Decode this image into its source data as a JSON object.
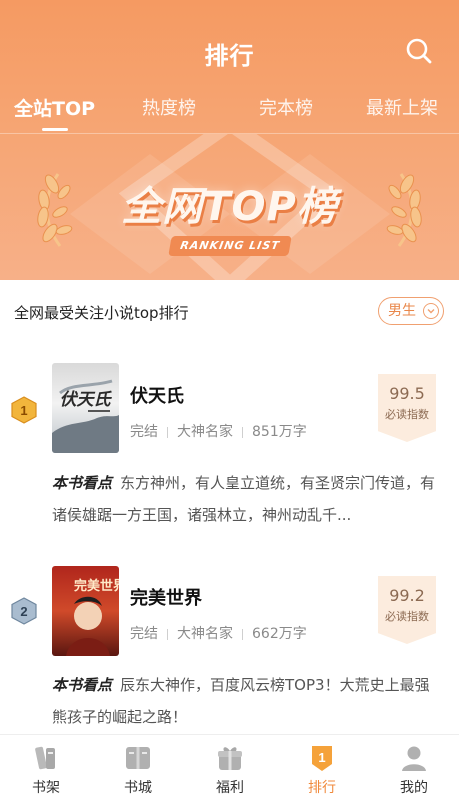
{
  "header": {
    "title": "排行",
    "search_icon": "search-icon"
  },
  "tabs": [
    {
      "label": "全站TOP",
      "active": true
    },
    {
      "label": "热度榜",
      "active": false
    },
    {
      "label": "完本榜",
      "active": false
    },
    {
      "label": "最新上架",
      "active": false
    }
  ],
  "banner": {
    "title": "全网TOP榜",
    "subtitle": "RANKING LIST"
  },
  "list_header": {
    "subtitle": "全网最受关注小说top排行",
    "gender_filter": "男生"
  },
  "books": [
    {
      "rank": "1",
      "title": "伏天氏",
      "cover_text": "伏天氏",
      "status": "完结",
      "author": "大神名家",
      "words": "851万字",
      "score": "99.5",
      "score_label": "必读指数",
      "highlight_label": "本书看点",
      "highlight_text": "东方神州，有人皇立道统，有圣贤宗门传道，有诸侯雄踞一方王国，诸强林立，神州动乱千..."
    },
    {
      "rank": "2",
      "title": "完美世界",
      "cover_text": "完美世界",
      "status": "完结",
      "author": "大神名家",
      "words": "662万字",
      "score": "99.2",
      "score_label": "必读指数",
      "highlight_label": "本书看点",
      "highlight_text": "辰东大神作，百度风云榜TOP3！大荒史上最强熊孩子的崛起之路！"
    }
  ],
  "bottom_nav": [
    {
      "label": "书架",
      "icon": "bookshelf-icon",
      "active": false
    },
    {
      "label": "书城",
      "icon": "book-store-icon",
      "active": false
    },
    {
      "label": "福利",
      "icon": "gift-icon",
      "active": false
    },
    {
      "label": "排行",
      "icon": "ranking-icon",
      "active": true
    },
    {
      "label": "我的",
      "icon": "profile-icon",
      "active": false
    }
  ],
  "colors": {
    "accent": "#f08a3c",
    "header_gradient_top": "#f59a62",
    "score_bg": "#fcecde",
    "gold_badge": "#f2b53c",
    "silver_badge": "#8fa6bf"
  }
}
